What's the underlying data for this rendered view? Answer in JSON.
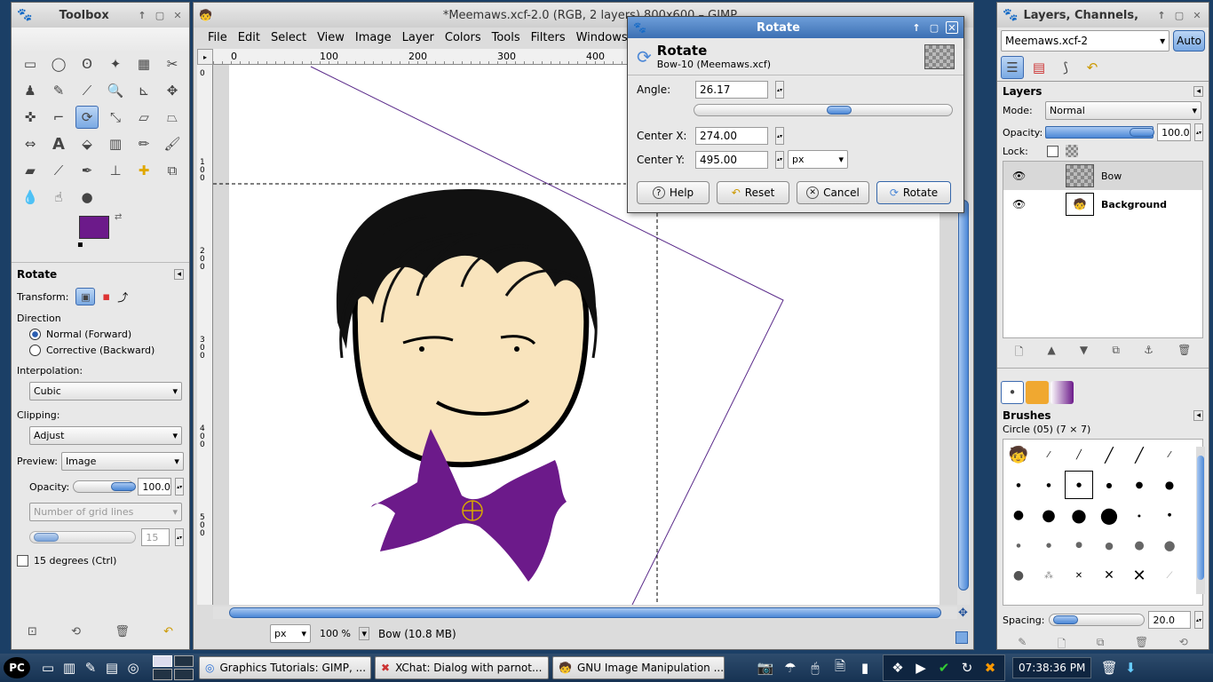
{
  "toolbox": {
    "title": "Toolbox",
    "tool_options_title": "Rotate",
    "transform_label": "Transform:",
    "direction_label": "Direction",
    "direction_normal": "Normal (Forward)",
    "direction_corrective": "Corrective (Backward)",
    "interpolation_label": "Interpolation:",
    "interpolation_value": "Cubic",
    "clipping_label": "Clipping:",
    "clipping_value": "Adjust",
    "preview_label": "Preview:",
    "preview_value": "Image",
    "opacity_label": "Opacity:",
    "opacity_value": "100.0",
    "grid_lines_value": "Number of grid lines",
    "grid_count": "15",
    "fifteen_degrees": "15 degrees  (Ctrl)",
    "fg_color": "#6c1a8a"
  },
  "image_window": {
    "title": "*Meemaws.xcf-2.0 (RGB, 2 layers) 800x600 – GIMP",
    "menu": [
      "File",
      "Edit",
      "Select",
      "View",
      "Image",
      "Layer",
      "Colors",
      "Tools",
      "Filters",
      "Windows"
    ],
    "ruler_h": [
      "0",
      "100",
      "200",
      "300",
      "400"
    ],
    "ruler_v": [
      "0",
      "1\n0\n0",
      "2\n0\n0",
      "3\n0\n0",
      "4\n0\n0",
      "5\n0\n0"
    ],
    "unit": "px",
    "zoom": "100 %",
    "status": "Bow (10.8 MB)"
  },
  "rotate_dialog": {
    "window_title": "Rotate",
    "heading": "Rotate",
    "subheading": "Bow-10 (Meemaws.xcf)",
    "angle_label": "Angle:",
    "angle_value": "26.17",
    "angle_fraction": 0.57,
    "center_x_label": "Center X:",
    "center_x_value": "274.00",
    "center_y_label": "Center Y:",
    "center_y_value": "495.00",
    "unit": "px",
    "help_label": "Help",
    "reset_label": "Reset",
    "cancel_label": "Cancel",
    "rotate_label": "Rotate"
  },
  "layers_panel": {
    "title": "Layers, Channels,",
    "image_select": "Meemaws.xcf-2",
    "auto_label": "Auto",
    "layers_title": "Layers",
    "mode_label": "Mode:",
    "mode_value": "Normal",
    "opacity_label": "Opacity:",
    "opacity_value": "100.0",
    "lock_label": "Lock:",
    "layers": [
      {
        "name": "Bow",
        "bold": false
      },
      {
        "name": "Background",
        "bold": true
      }
    ],
    "brushes_title": "Brushes",
    "brush_name": "Circle (05) (7 × 7)",
    "spacing_label": "Spacing:",
    "spacing_value": "20.0"
  },
  "taskbar": {
    "tasks": [
      "Graphics Tutorials: GIMP, ...",
      "XChat: Dialog with parnot...",
      "GNU Image Manipulation ..."
    ],
    "clock": "07:38:36 PM"
  },
  "colors": {
    "accent": "#4b87d6",
    "bow": "#6c1a8a",
    "skin": "#f9e4bd"
  }
}
